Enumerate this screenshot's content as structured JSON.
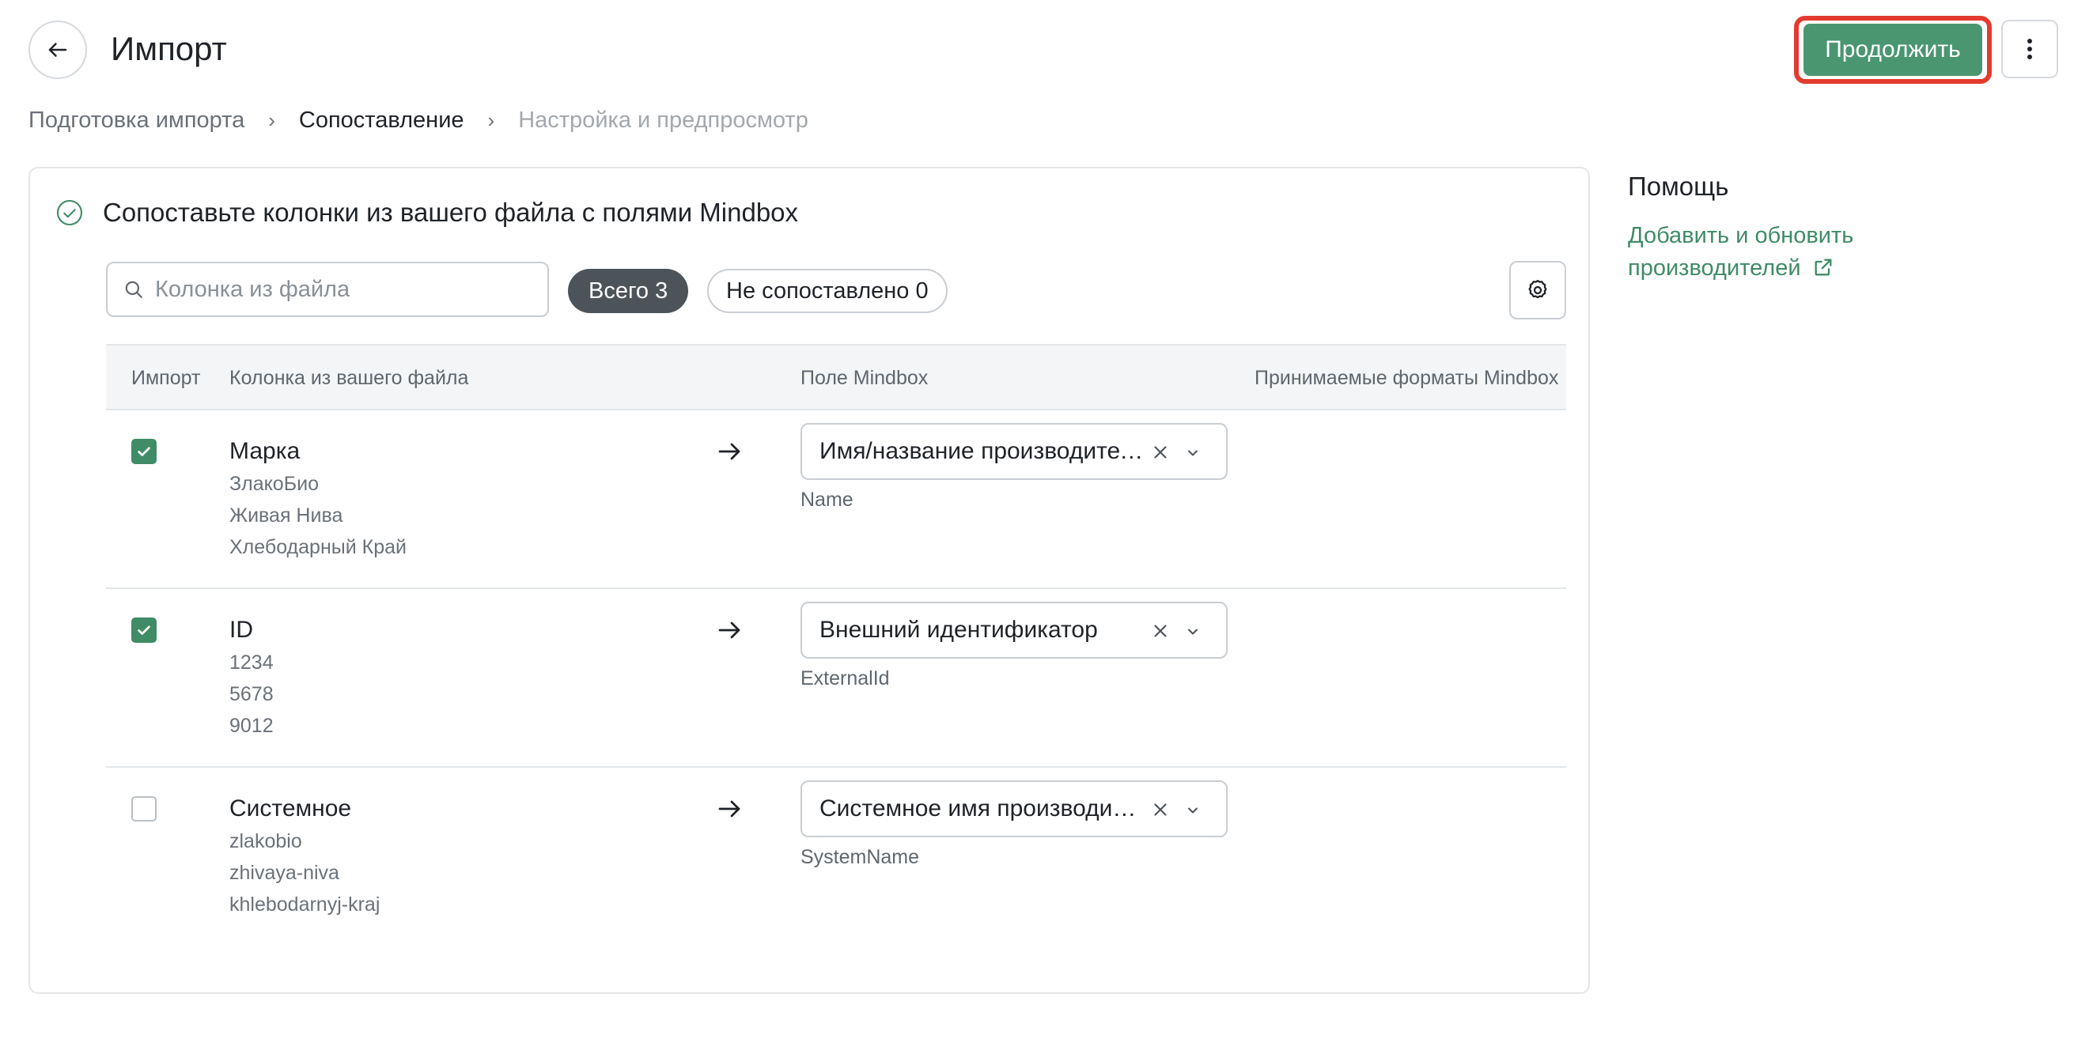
{
  "header": {
    "title": "Импорт",
    "back_icon": "arrow-left-icon",
    "continue_label": "Продолжить",
    "more_icon": "kebab-menu-icon"
  },
  "breadcrumb": {
    "steps": [
      "Подготовка импорта",
      "Сопоставление",
      "Настройка и предпросмотр"
    ],
    "separator": "›"
  },
  "card": {
    "title": "Сопоставьте колонки из вашего файла с полями Mindbox",
    "search_placeholder": "Колонка из файла",
    "filter_all": "Всего 3",
    "filter_unmatched": "Не сопоставлено 0"
  },
  "table": {
    "headers": [
      "Импорт",
      "Колонка из вашего файла",
      "Поле Mindbox",
      "Принимаемые форматы Mindbox"
    ],
    "rows": [
      {
        "checked": true,
        "column": "Марка",
        "samples": [
          "ЗлакоБио",
          "Живая Нива",
          "Хлебодарный Край"
        ],
        "field": "Имя/название производителя",
        "system": "Name"
      },
      {
        "checked": true,
        "column": "ID",
        "samples": [
          "1234",
          "5678",
          "9012"
        ],
        "field": "Внешний идентификатор",
        "system": "ExternalId"
      },
      {
        "checked": false,
        "column": "Системное",
        "samples": [
          "zlakobio",
          "zhivaya-niva",
          "khlebodarnyj-kraj"
        ],
        "field": "Системное имя производителя",
        "system": "SystemName"
      }
    ]
  },
  "help": {
    "title": "Помощь",
    "link_line1": "Добавить и обновить",
    "link_line2": "производителей"
  },
  "colors": {
    "accent": "#4a9670",
    "checkbox": "#3f8c66",
    "highlight": "#e33b2e",
    "pill_dark": "#4c5359"
  }
}
